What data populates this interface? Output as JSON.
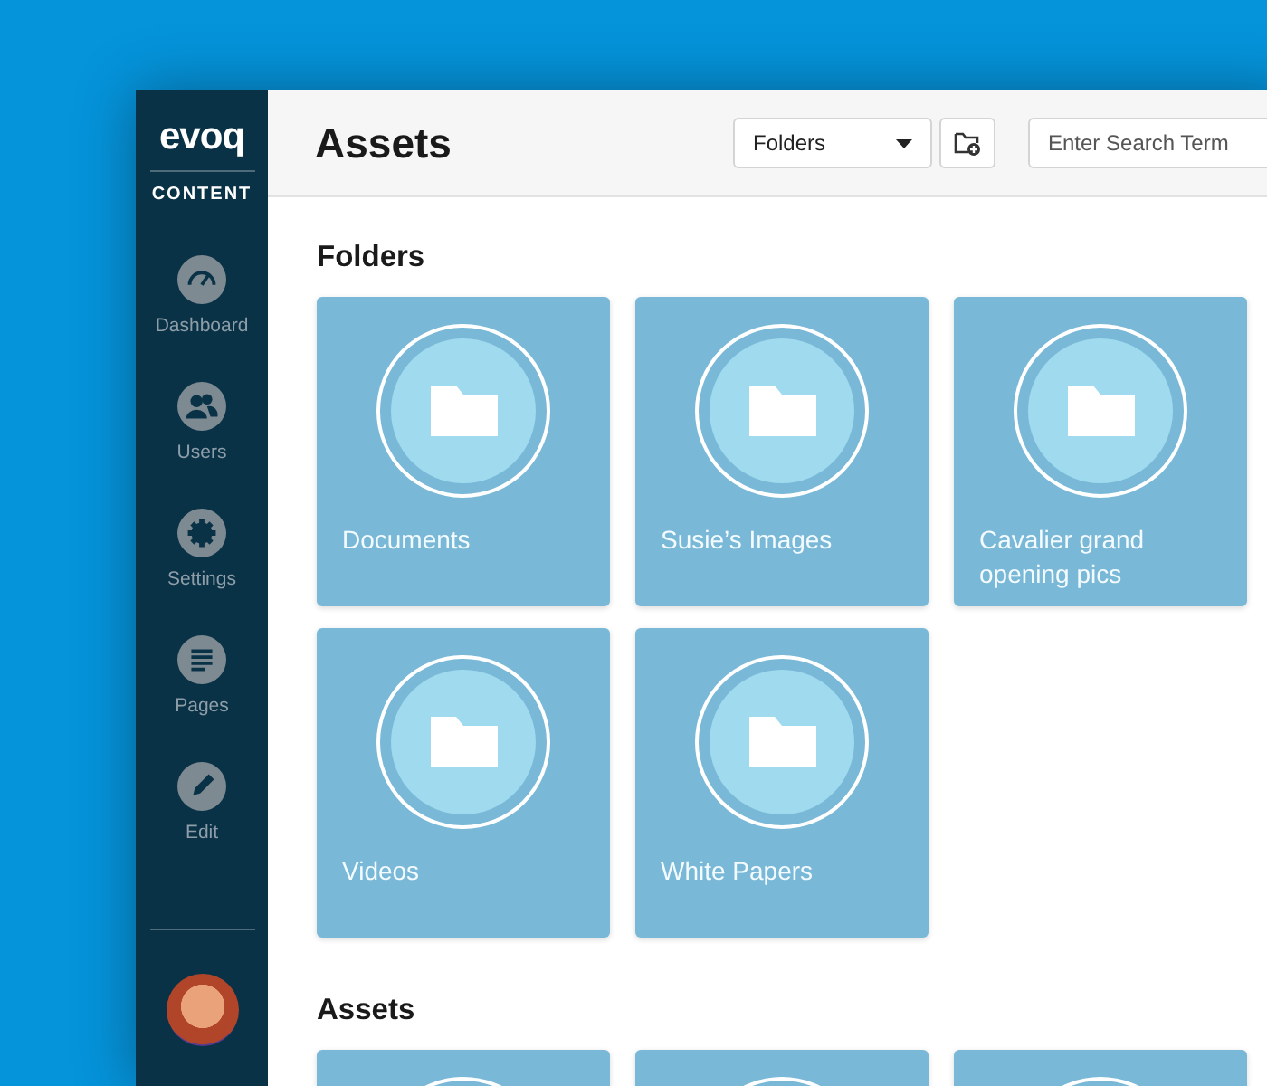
{
  "sidebar": {
    "logo": "evoq",
    "product": "CONTENT",
    "items": [
      {
        "kind": "dashboard",
        "label": "Dashboard"
      },
      {
        "kind": "users",
        "label": "Users"
      },
      {
        "kind": "settings",
        "label": "Settings"
      },
      {
        "kind": "pages",
        "label": "Pages"
      },
      {
        "kind": "edit",
        "label": "Edit"
      }
    ]
  },
  "header": {
    "title": "Assets",
    "filter": {
      "value": "Folders"
    },
    "search": {
      "placeholder": "Enter Search Term"
    }
  },
  "folders": {
    "title": "Folders",
    "items": [
      {
        "name": "Documents"
      },
      {
        "name": "Susie’s Images"
      },
      {
        "name": "Cavalier grand opening pics"
      },
      {
        "name": "Videos"
      },
      {
        "name": "White Papers"
      }
    ]
  },
  "assets": {
    "title": "Assets",
    "cards": [
      {
        "kind": "asset"
      },
      {
        "kind": "asset"
      },
      {
        "kind": "asset"
      }
    ]
  }
}
